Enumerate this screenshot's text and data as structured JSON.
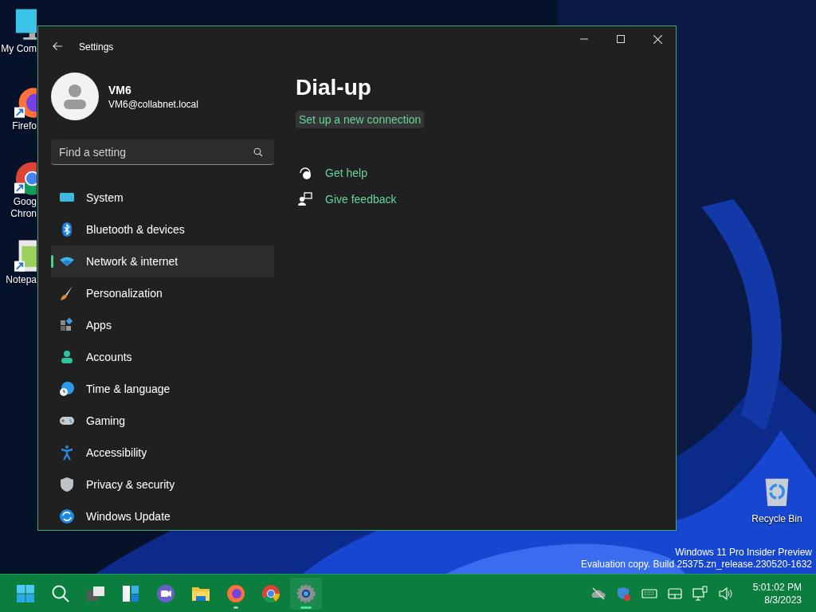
{
  "desktop": {
    "icons": [
      {
        "lines": [
          "My Com"
        ],
        "kind": "computer"
      },
      {
        "lines": [
          "Firefo"
        ],
        "kind": "firefox",
        "shortcut": true
      },
      {
        "lines": [
          "Goog",
          "Chron"
        ],
        "kind": "chrome",
        "shortcut": true
      },
      {
        "lines": [
          "Notepa"
        ],
        "kind": "notepad",
        "shortcut": true
      }
    ],
    "recycle_bin": {
      "label": "Recycle Bin"
    },
    "build_info": [
      "Windows 11 Pro Insider Preview",
      "Evaluation copy. Build 25375.zn_release.230520-1632"
    ]
  },
  "window": {
    "title": "Settings",
    "user": {
      "name": "VM6",
      "email": "VM6@collabnet.local"
    },
    "search": {
      "placeholder": "Find a setting"
    },
    "nav": [
      {
        "label": "System",
        "kind": "system",
        "selected": false
      },
      {
        "label": "Bluetooth & devices",
        "kind": "bluetooth",
        "selected": false
      },
      {
        "label": "Network & internet",
        "kind": "network",
        "selected": true
      },
      {
        "label": "Personalization",
        "kind": "brush",
        "selected": false
      },
      {
        "label": "Apps",
        "kind": "apps",
        "selected": false
      },
      {
        "label": "Accounts",
        "kind": "accounts",
        "selected": false
      },
      {
        "label": "Time & language",
        "kind": "time",
        "selected": false
      },
      {
        "label": "Gaming",
        "kind": "gaming",
        "selected": false
      },
      {
        "label": "Accessibility",
        "kind": "accessibility",
        "selected": false
      },
      {
        "label": "Privacy & security",
        "kind": "shield",
        "selected": false
      },
      {
        "label": "Windows Update",
        "kind": "update",
        "selected": false
      }
    ],
    "page": {
      "title": "Dial-up",
      "link": {
        "label": "Set up a new connection",
        "hovered": true
      },
      "help_links": [
        {
          "label": "Get help",
          "kind": "help"
        },
        {
          "label": "Give feedback",
          "kind": "feedback"
        }
      ]
    }
  },
  "taskbar": {
    "apps": [
      {
        "kind": "start",
        "running": false,
        "active": false
      },
      {
        "kind": "search",
        "running": false,
        "active": false
      },
      {
        "kind": "taskview",
        "running": false,
        "active": false
      },
      {
        "kind": "widgets",
        "running": false,
        "active": false
      },
      {
        "kind": "chat",
        "running": false,
        "active": false
      },
      {
        "kind": "explorer",
        "running": false,
        "active": false
      },
      {
        "kind": "firefox",
        "running": true,
        "active": false
      },
      {
        "kind": "chrome",
        "running": false,
        "active": false
      },
      {
        "kind": "settings",
        "running": true,
        "active": true
      }
    ],
    "tray": [
      {
        "kind": "cloud-off"
      },
      {
        "kind": "defender"
      },
      {
        "kind": "keyboard"
      },
      {
        "kind": "touchpad"
      },
      {
        "kind": "network"
      },
      {
        "kind": "volume"
      }
    ],
    "time": "5:01:02 PM",
    "date": "8/3/2023"
  }
}
